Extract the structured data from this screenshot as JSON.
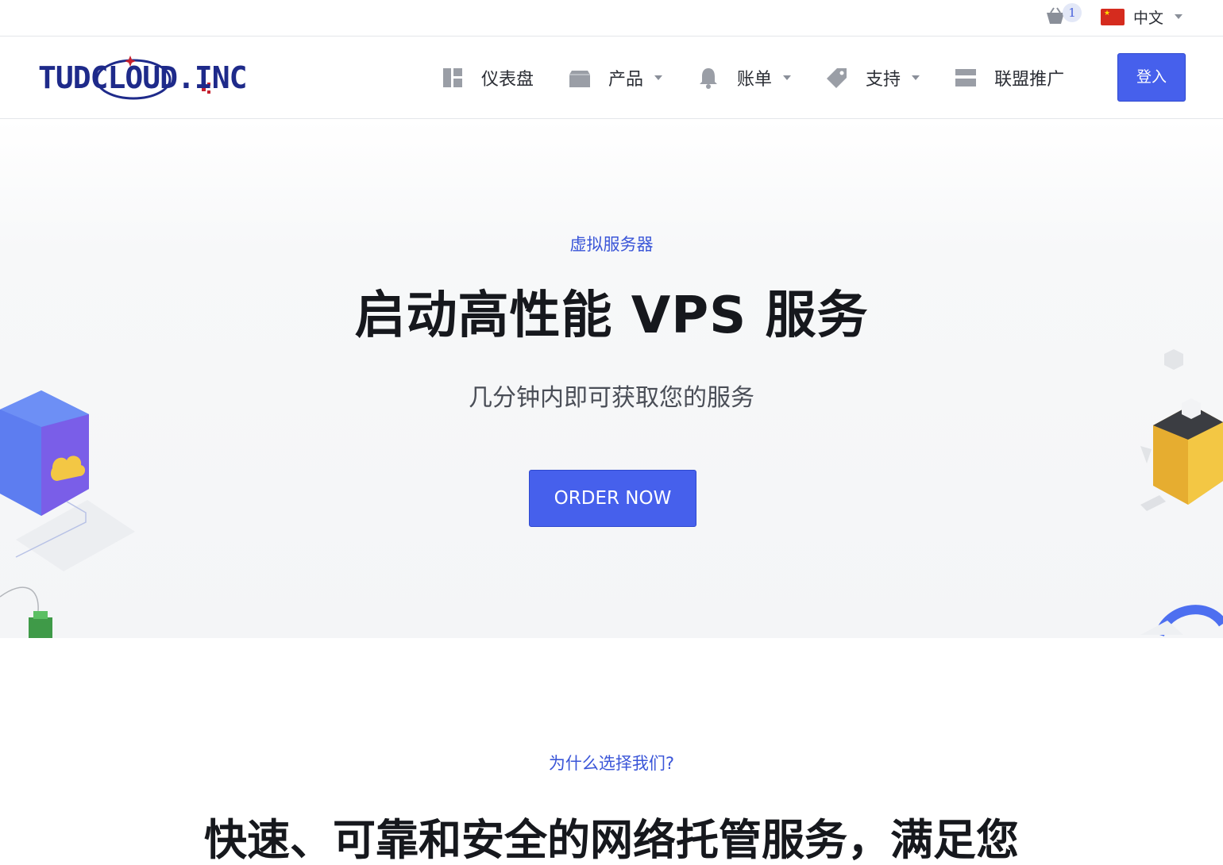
{
  "topbar": {
    "cart_count": "1",
    "language": "中文"
  },
  "brand": {
    "logo_text": "TUDCLOUD.INC"
  },
  "nav": {
    "items": [
      {
        "label": "仪表盘",
        "icon": "dashboard-icon"
      },
      {
        "label": "产品",
        "icon": "box-icon"
      },
      {
        "label": "账单",
        "icon": "bell-icon"
      },
      {
        "label": "支持",
        "icon": "tag-icon"
      },
      {
        "label": "联盟推广",
        "icon": "credit-card-icon"
      }
    ],
    "login_label": "登入"
  },
  "hero": {
    "eyebrow": "虚拟服务器",
    "title": "启动高性能 VPS 服务",
    "subtitle": "几分钟内即可获取您的服务",
    "cta": "ORDER NOW"
  },
  "why": {
    "eyebrow": "为什么选择我们?",
    "title": "快速、可靠和安全的网络托管服务，满足您"
  },
  "colors": {
    "accent": "#4660ec",
    "accent_text": "#3b56d8",
    "logo_navy": "#1e2a8a",
    "logo_red": "#c6202e"
  }
}
